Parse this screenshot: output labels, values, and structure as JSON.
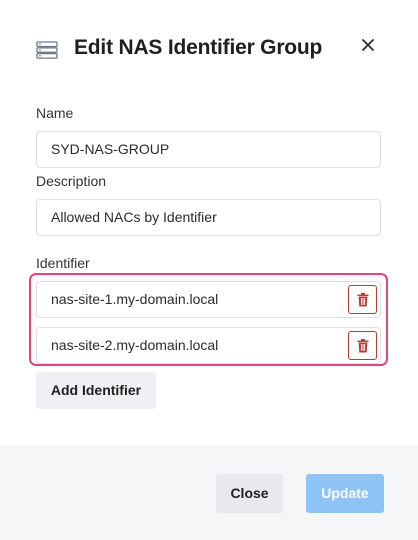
{
  "dialog": {
    "title": "Edit NAS Identifier Group",
    "header_icon": "server-list-icon",
    "close_icon": "close-icon"
  },
  "form": {
    "name_label": "Name",
    "name_value": "SYD-NAS-GROUP",
    "description_label": "Description",
    "description_value": "Allowed NACs by Identifier",
    "identifier_label": "Identifier",
    "identifiers": [
      {
        "value": "nas-site-1.my-domain.local",
        "delete_icon": "trash-icon"
      },
      {
        "value": "nas-site-2.my-domain.local",
        "delete_icon": "trash-icon"
      }
    ],
    "add_identifier_label": "Add Identifier"
  },
  "footer": {
    "close_label": "Close",
    "update_label": "Update"
  },
  "colors": {
    "highlight_border": "#e0457b",
    "delete_red": "#b63a3a",
    "update_button": "#8ec3f7",
    "footer_bg": "#f5f6f8"
  }
}
